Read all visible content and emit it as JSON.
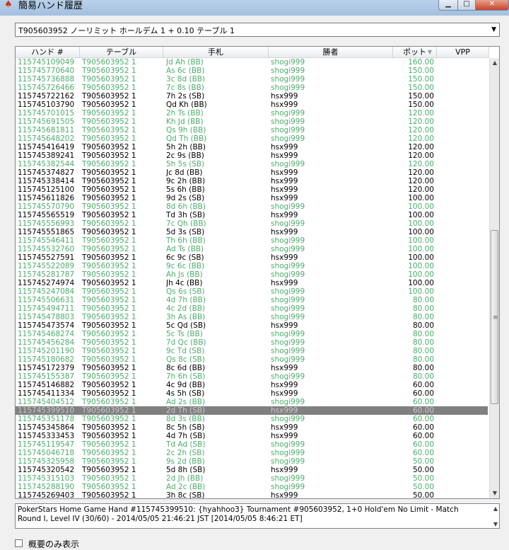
{
  "window": {
    "title": "簡易ハンド履歴"
  },
  "table_select": {
    "value": "T905603952 ノーリミット ホールデム 1 + 0.10 テーブル 1"
  },
  "columns": [
    "ハンド #",
    "テーブル",
    "手札",
    "勝者",
    "ポット",
    "VPP"
  ],
  "colors": {
    "winner_shogi": "#4cad6c",
    "winner_hsx": "#000000",
    "selected_bg": "#808080"
  },
  "rows": [
    [
      "115745109049",
      "T905603952 1",
      "Jd Ah (BB)",
      "shogi999",
      "160.00"
    ],
    [
      "115745770640",
      "T905603952 1",
      "As 6c (BB)",
      "shogi999",
      "150.00"
    ],
    [
      "115745736888",
      "T905603952 1",
      "3c 8d (BB)",
      "shogi999",
      "150.00"
    ],
    [
      "115745726466",
      "T905603952 1",
      "7c 8s (BB)",
      "shogi999",
      "150.00"
    ],
    [
      "115745722162",
      "T905603952 1",
      "7h 2s (SB)",
      "hsx999",
      "150.00"
    ],
    [
      "115745103790",
      "T905603952 1",
      "Qd Kh (BB)",
      "hsx999",
      "150.00"
    ],
    [
      "115745701015",
      "T905603952 1",
      "2h Ts (BB)",
      "shogi999",
      "120.00"
    ],
    [
      "115745691505",
      "T905603952 1",
      "Kh Jd (BB)",
      "shogi999",
      "120.00"
    ],
    [
      "115745681811",
      "T905603952 1",
      "Qs 9h (BB)",
      "shogi999",
      "120.00"
    ],
    [
      "115745648202",
      "T905603952 1",
      "Qd Th (BB)",
      "shogi999",
      "120.00"
    ],
    [
      "115745416419",
      "T905603952 1",
      "5h 2h (BB)",
      "hsx999",
      "120.00"
    ],
    [
      "115745389241",
      "T905603952 1",
      "2c 9s (BB)",
      "hsx999",
      "120.00"
    ],
    [
      "115745382544",
      "T905603952 1",
      "5h 5s (SB)",
      "shogi999",
      "120.00"
    ],
    [
      "115745374827",
      "T905603952 1",
      "Jc 8d (BB)",
      "hsx999",
      "120.00"
    ],
    [
      "115745338414",
      "T905603952 1",
      "9c 2h (BB)",
      "hsx999",
      "120.00"
    ],
    [
      "115745125100",
      "T905603952 1",
      "5s 6h (BB)",
      "hsx999",
      "120.00"
    ],
    [
      "115745611826",
      "T905603952 1",
      "9d 2s (SB)",
      "hsx999",
      "100.00"
    ],
    [
      "115745570790",
      "T905603952 1",
      "8d 6h (BB)",
      "shogi999",
      "100.00"
    ],
    [
      "115745565519",
      "T905603952 1",
      "Td 3h (SB)",
      "hsx999",
      "100.00"
    ],
    [
      "115745556993",
      "T905603952 1",
      "7c Qh (BB)",
      "shogi999",
      "100.00"
    ],
    [
      "115745551865",
      "T905603952 1",
      "5d 3s (SB)",
      "hsx999",
      "100.00"
    ],
    [
      "115745546411",
      "T905603952 1",
      "Th 6h (BB)",
      "shogi999",
      "100.00"
    ],
    [
      "115745532760",
      "T905603952 1",
      "Ad Ts (BB)",
      "shogi999",
      "100.00"
    ],
    [
      "115745527591",
      "T905603952 1",
      "6c 9c (SB)",
      "hsx999",
      "100.00"
    ],
    [
      "115745522089",
      "T905603952 1",
      "9c 6c (BB)",
      "shogi999",
      "100.00"
    ],
    [
      "115745281787",
      "T905603952 1",
      "Ah Js (BB)",
      "shogi999",
      "100.00"
    ],
    [
      "115745274974",
      "T905603952 1",
      "Jh 4c (BB)",
      "hsx999",
      "100.00"
    ],
    [
      "115745247084",
      "T905603952 1",
      "Qs 6s (SB)",
      "shogi999",
      "100.00"
    ],
    [
      "115745506631",
      "T905603952 1",
      "4d 7h (BB)",
      "shogi999",
      "80.00"
    ],
    [
      "115745494711",
      "T905603952 1",
      "4c 2d (BB)",
      "shogi999",
      "80.00"
    ],
    [
      "115745478803",
      "T905603952 1",
      "3h As (BB)",
      "shogi999",
      "80.00"
    ],
    [
      "115745473574",
      "T905603952 1",
      "5c Qd (SB)",
      "hsx999",
      "80.00"
    ],
    [
      "115745468274",
      "T905603952 1",
      "5c Ts (BB)",
      "shogi999",
      "80.00"
    ],
    [
      "115745456284",
      "T905603952 1",
      "7d Qc (BB)",
      "shogi999",
      "80.00"
    ],
    [
      "115745201190",
      "T905603952 1",
      "9c Td (SB)",
      "shogi999",
      "80.00"
    ],
    [
      "115745180682",
      "T905603952 1",
      "Qs 8c (SB)",
      "shogi999",
      "80.00"
    ],
    [
      "115745172379",
      "T905603952 1",
      "8c 6d (BB)",
      "hsx999",
      "80.00"
    ],
    [
      "115745155387",
      "T905603952 1",
      "7h 6h (SB)",
      "shogi999",
      "80.00"
    ],
    [
      "115745146882",
      "T905603952 1",
      "4c 9d (BB)",
      "hsx999",
      "60.00"
    ],
    [
      "115745411334",
      "T905603952 1",
      "4s 5h (SB)",
      "hsx999",
      "60.00"
    ],
    [
      "115745404512",
      "T905603952 1",
      "Ad 2s (BB)",
      "shogi999",
      "60.00"
    ],
    [
      "115745399510",
      "T905603952 1",
      "2d Th (SB)",
      "hsx999",
      "60.00"
    ],
    [
      "115745351178",
      "T905603952 1",
      "8d 3s (BB)",
      "shogi999",
      "60.00"
    ],
    [
      "115745345864",
      "T905603952 1",
      "8c 5h (SB)",
      "hsx999",
      "60.00"
    ],
    [
      "115745333453",
      "T905603952 1",
      "4d 7h (SB)",
      "hsx999",
      "60.00"
    ],
    [
      "115745119547",
      "T905603952 1",
      "Td Ad (SB)",
      "shogi999",
      "60.00"
    ],
    [
      "115745046718",
      "T905603952 1",
      "2c 2h (SB)",
      "shogi999",
      "60.00"
    ],
    [
      "115745325958",
      "T905603952 1",
      "9s 2d (BB)",
      "shogi999",
      "50.00"
    ],
    [
      "115745320542",
      "T905603952 1",
      "5d 8h (SB)",
      "hsx999",
      "50.00"
    ],
    [
      "115745315103",
      "T905603952 1",
      "2d Jh (BB)",
      "shogi999",
      "50.00"
    ],
    [
      "115745288190",
      "T905603952 1",
      "Ad 2c (BB)",
      "shogi999",
      "50.00"
    ],
    [
      "115745269403",
      "T905603952 1",
      "3h 8c (SB)",
      "hsx999",
      "50.00"
    ]
  ],
  "selected_index": 41,
  "detail": {
    "text": "PokerStars Home Game Hand #115745399510: {hyahhoo3} Tournament #905603952, 1+0 Hold'em No Limit - Match Round I, Level IV (30/60) - 2014/05/05 21:46:21 JST [2014/05/05 8:46:21 ET]"
  },
  "summary": {
    "label": "概要のみ表示"
  }
}
